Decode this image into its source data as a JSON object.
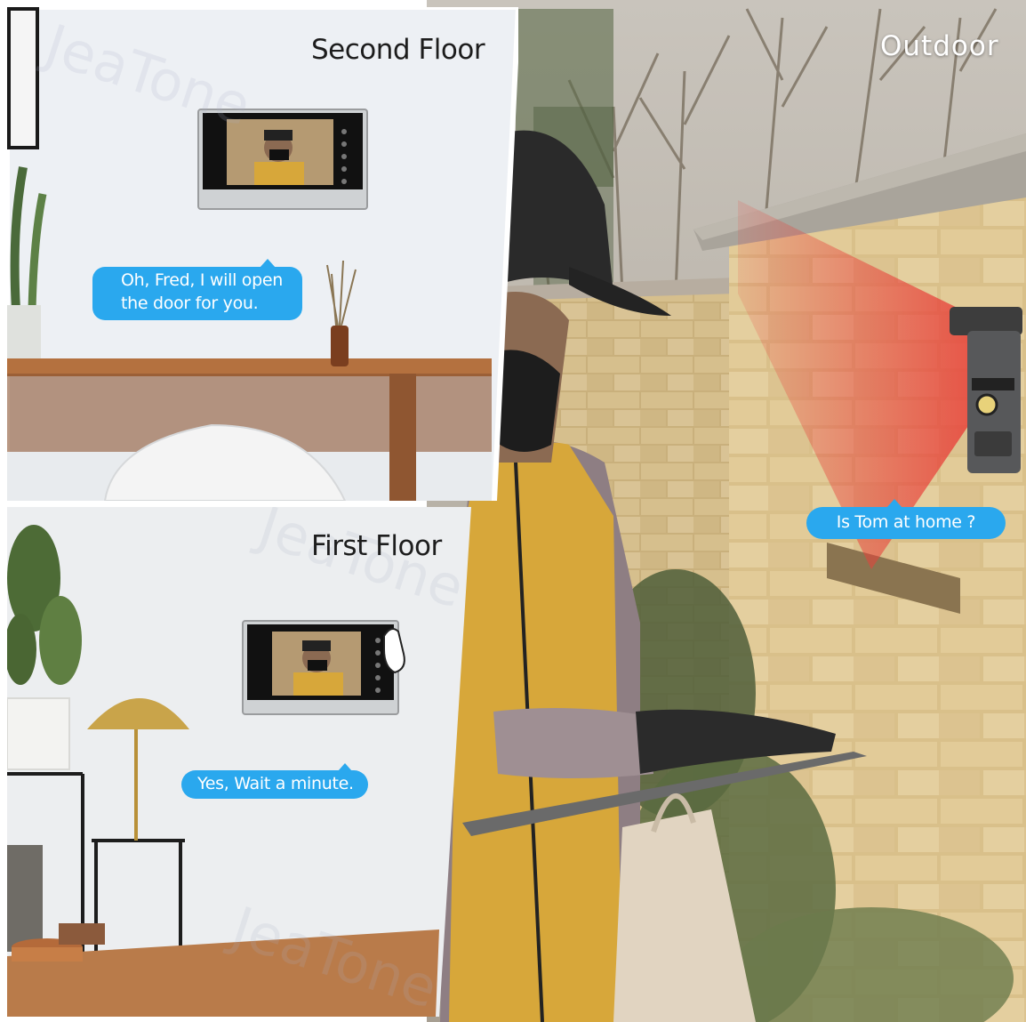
{
  "panels": {
    "second_floor": {
      "title": "Second Floor",
      "speech": [
        "Oh, Fred, I will open",
        "the door for you."
      ]
    },
    "first_floor": {
      "title": "First Floor",
      "speech": [
        "Yes, Wait a minute."
      ]
    },
    "outdoor": {
      "title": "Outdoor",
      "speech": [
        "Is Tom at home ?"
      ]
    }
  },
  "watermark": "JeaTone",
  "colors": {
    "bubble": "#2aa8ee",
    "brick": "#d9c08a",
    "vest": "#d7a73a",
    "beam": "#e8413a"
  }
}
